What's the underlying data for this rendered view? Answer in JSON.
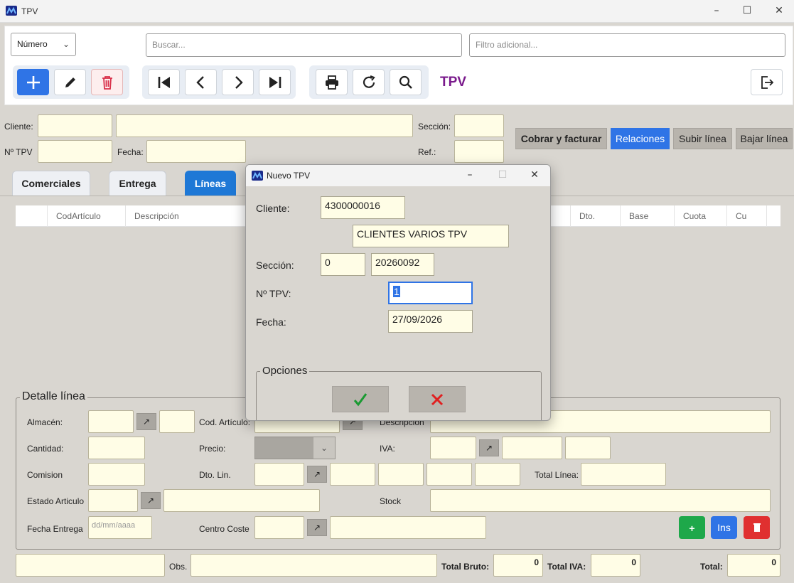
{
  "window": {
    "title": "TPV"
  },
  "toolbar": {
    "sort_select": "Número",
    "search_placeholder": "Buscar...",
    "filter_placeholder": "Filtro adicional...",
    "page_title": "TPV"
  },
  "header": {
    "cliente_label": "Cliente:",
    "ntpv_label": "Nº TPV",
    "fecha_label": "Fecha:",
    "seccion_label": "Sección:",
    "ref_label": "Ref.:",
    "cobrar": "Cobrar y facturar",
    "relaciones": "Relaciones",
    "subir": "Subir línea",
    "bajar": "Bajar línea"
  },
  "tabs": [
    "Comerciales",
    "Entrega",
    "Líneas"
  ],
  "grid": {
    "columns": [
      "CodArtículo",
      "Descripción",
      "Dto.",
      "Base",
      "Cuota",
      "Cu"
    ]
  },
  "detalle": {
    "legend": "Detalle línea",
    "almacen": "Almacén:",
    "cod_articulo": "Cod. Artículo:",
    "descripcion": "Descripción",
    "cantidad": "Cantidad:",
    "precio": "Precio:",
    "iva": "IVA:",
    "comision": "Comision",
    "dto_lin": "Dto. Lin.",
    "total_linea": "Total Línea:",
    "estado_articulo": "Estado Articulo",
    "stock": "Stock",
    "fecha_entrega": "Fecha Entrega",
    "fecha_placeholder": "dd/mm/aaaa",
    "centro_coste": "Centro Coste",
    "add_label": "+",
    "ins_label": "Ins"
  },
  "footer": {
    "obs": "Obs.",
    "total_bruto_label": "Total Bruto:",
    "total_bruto": "0",
    "total_iva_label": "Total IVA:",
    "total_iva": "0",
    "total_label": "Total:",
    "total": "0"
  },
  "dialog": {
    "title": "Nuevo TPV",
    "cliente_label": "Cliente:",
    "cliente_code": "4300000016",
    "cliente_name": "CLIENTES VARIOS TPV",
    "seccion_label": "Sección:",
    "seccion_value": "0",
    "seccion_code": "20260092",
    "ntpv_label": "Nº TPV:",
    "ntpv_value": "1",
    "fecha_label": "Fecha:",
    "fecha_value": "27/09/2026",
    "opciones_legend": "Opciones"
  },
  "colors": {
    "accent": "#2f74e6",
    "brand_purple": "#7a1a8c",
    "danger": "#e03030",
    "success": "#1ea84a",
    "field_yellow": "#fffde6"
  }
}
